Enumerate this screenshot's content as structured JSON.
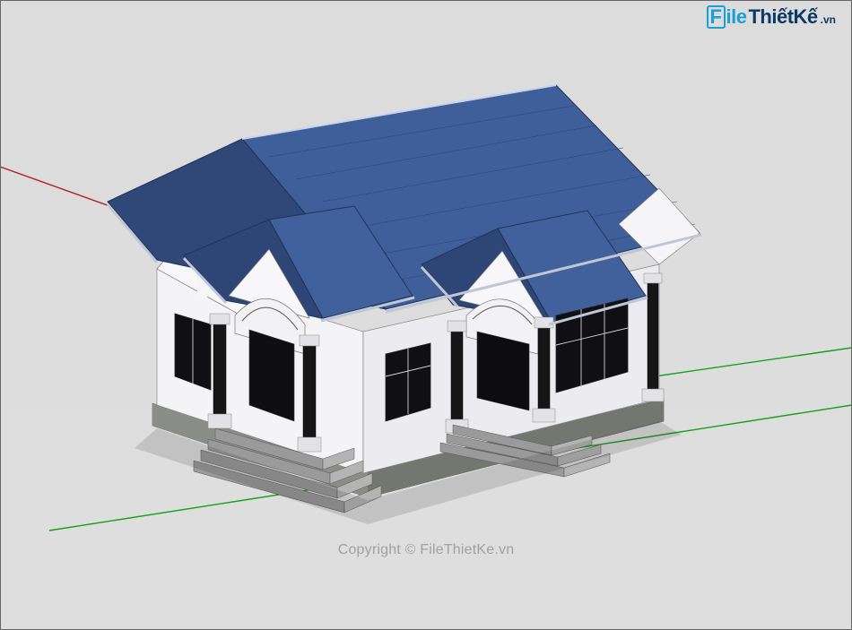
{
  "watermark": {
    "logo_part1": "File",
    "logo_part2": "ThiếtKế",
    "logo_suffix": ".vn",
    "copyright": "Copyright © FileThietKe.vn"
  },
  "scene": {
    "description": "SketchUp 3D viewport with a single-story house model, blue tiled gable roof, white walls, dark columns, stone plinth, steps at two porches. Red/green/blue axis lines visible.",
    "axes": {
      "red": "x-axis (red line receding left)",
      "green": "y-axis (green line receding right)",
      "blue": "z-axis (vertical, mostly hidden behind model)"
    },
    "colors": {
      "roof": "#3f5f9a",
      "roof_shade": "#2f4878",
      "wall": "#f7f7f9",
      "trim": "#e8e8ee",
      "column": "#1b1b1b",
      "stone": "#8a8d88",
      "ground": "#dcdcdc"
    }
  }
}
